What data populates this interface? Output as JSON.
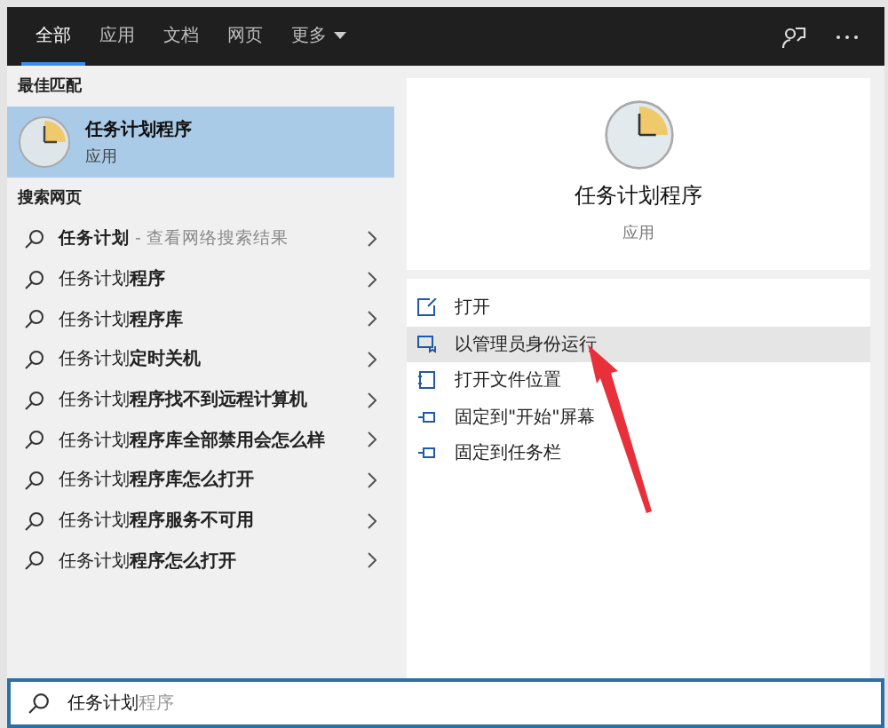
{
  "tabs": [
    {
      "label": "全部",
      "selected": true
    },
    {
      "label": "应用",
      "selected": false
    },
    {
      "label": "文档",
      "selected": false
    },
    {
      "label": "网页",
      "selected": false
    },
    {
      "label": "更多",
      "selected": false,
      "dropdown": true
    }
  ],
  "best_match": {
    "heading": "最佳匹配",
    "title": "任务计划程序",
    "subtitle": "应用",
    "selected": true
  },
  "web": {
    "heading": "搜索网页",
    "items": [
      {
        "text": "**任务计划** - 查看网络搜索结果",
        "kind": "web"
      },
      {
        "text": "任务计划**程序**",
        "kind": "suggestion"
      },
      {
        "text": "任务计划**程序库**",
        "kind": "suggestion"
      },
      {
        "text": "任务计划**定时关机**",
        "kind": "suggestion"
      },
      {
        "text": "任务计划**程序找不到远程计算机**",
        "kind": "suggestion"
      },
      {
        "text": "任务计划**程序库全部禁用会怎么样**",
        "kind": "suggestion"
      },
      {
        "text": "任务计划**程序库怎么打开**",
        "kind": "suggestion"
      },
      {
        "text": "任务计划**程序服务不可用**",
        "kind": "suggestion"
      },
      {
        "text": "任务计划**程序怎么打开**",
        "kind": "suggestion"
      }
    ]
  },
  "detail": {
    "title": "任务计划程序",
    "subtitle": "应用",
    "actions": [
      {
        "label": "打开",
        "kind": "open",
        "selected": false
      },
      {
        "label": "以管理员身份运行",
        "kind": "admin",
        "selected": true
      },
      {
        "label": "打开文件位置",
        "kind": "folder",
        "selected": false
      },
      {
        "label": "固定到\"开始\"屏幕",
        "kind": "pin",
        "selected": false
      },
      {
        "label": "固定到任务栏",
        "kind": "pin",
        "selected": false
      }
    ]
  },
  "search": {
    "value": "任务计划",
    "completion": "程序"
  }
}
